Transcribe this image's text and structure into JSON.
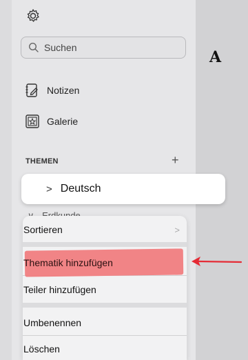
{
  "sidebar": {
    "search_placeholder": "Suchen",
    "nav": [
      {
        "label": "Notizen",
        "icon": "notes-icon"
      },
      {
        "label": "Galerie",
        "icon": "gallery-icon"
      }
    ],
    "section_title": "THEMEN",
    "add_label": "+"
  },
  "topics": {
    "selected": {
      "chevron": ">",
      "label": "Deutsch"
    },
    "behind": {
      "chevron": "∨",
      "label": "Erdkunde"
    }
  },
  "context_menu": {
    "items": [
      {
        "label": "Sortieren",
        "has_submenu": true,
        "submenu_chevron": ">"
      },
      {
        "label": "Thematik hinzufügen"
      },
      {
        "label": "Teiler hinzufügen"
      },
      {
        "label": "Umbenennen"
      },
      {
        "label": "Löschen"
      }
    ]
  },
  "main": {
    "title": "A"
  },
  "annotation": {
    "highlight_color": "#f07d7f",
    "arrow_color": "#e52b35"
  }
}
